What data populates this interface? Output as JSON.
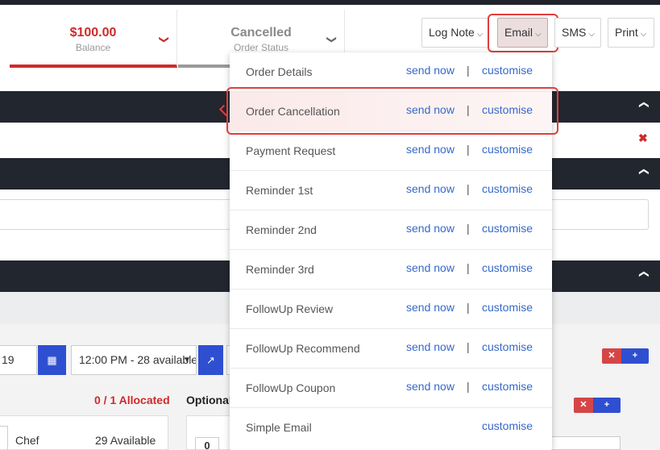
{
  "header": {
    "balance": {
      "value": "$100.00",
      "label": "Balance"
    },
    "status": {
      "value": "Cancelled",
      "label": "Order Status"
    },
    "toolbar": {
      "log_note": "Log Note",
      "email": "Email",
      "sms": "SMS",
      "print": "Print"
    }
  },
  "email_menu": {
    "send_label": "send now",
    "separator": "|",
    "customise_label": "customise",
    "items": [
      {
        "name": "Order Details",
        "send": "send now",
        "sep": "|",
        "customise": "customise"
      },
      {
        "name": "Order Cancellation",
        "send": "send now",
        "sep": "|",
        "customise": "customise"
      },
      {
        "name": "Payment Request",
        "send": "send now",
        "sep": "|",
        "customise": "customise"
      },
      {
        "name": "Reminder 1st",
        "send": "send now",
        "sep": "|",
        "customise": "customise"
      },
      {
        "name": "Reminder 2nd",
        "send": "send now",
        "sep": "|",
        "customise": "customise"
      },
      {
        "name": "Reminder 3rd",
        "send": "send now",
        "sep": "|",
        "customise": "customise"
      },
      {
        "name": "FollowUp Review",
        "send": "send now",
        "sep": "|",
        "customise": "customise"
      },
      {
        "name": "FollowUp Recommend",
        "send": "send now",
        "sep": "|",
        "customise": "customise"
      },
      {
        "name": "FollowUp Coupon",
        "send": "send now",
        "sep": "|",
        "customise": "customise"
      },
      {
        "name": "Simple Email",
        "customise": "customise"
      }
    ]
  },
  "booking": {
    "date_value": "19",
    "time_value": "12:00 PM - 28 available",
    "allocated": "0 / 1 Allocated",
    "optional": "Optional",
    "resource_name": "Chef",
    "resource_availability": "29 Available",
    "qty_value": "0"
  },
  "icons": {
    "calendar": "calendar-icon",
    "external_link": "external-link-icon",
    "remove": "close-icon",
    "add": "plus-icon",
    "collapse": "chevron-up-icon"
  },
  "colors": {
    "accent_red": "#cf2a2a",
    "primary_blue": "#2f4fd1",
    "link_blue": "#3569c9",
    "dark_bar": "#22262e"
  }
}
